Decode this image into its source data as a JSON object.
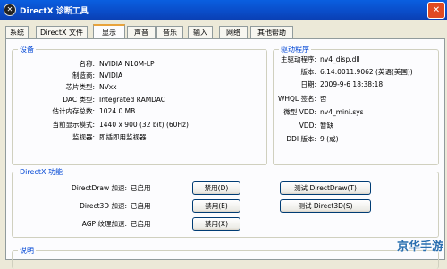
{
  "window": {
    "title": "DirectX 诊断工具",
    "close_glyph": "✕"
  },
  "tabs": [
    "系统",
    "DirectX 文件",
    "显示",
    "声音",
    "音乐",
    "输入",
    "网络",
    "其他帮助"
  ],
  "device": {
    "legend": "设备",
    "rows": [
      {
        "label": "名称:",
        "value": "NVIDIA N10M-LP"
      },
      {
        "label": "制造商:",
        "value": "NVIDIA"
      },
      {
        "label": "芯片类型:",
        "value": "NVxx"
      },
      {
        "label": "DAC 类型:",
        "value": "Integrated RAMDAC"
      },
      {
        "label": "估计内存总数:",
        "value": "1024.0 MB"
      },
      {
        "label": "当前显示模式:",
        "value": "1440 x 900 (32 bit) (60Hz)"
      },
      {
        "label": "监视器:",
        "value": "即插即用监视器"
      }
    ]
  },
  "driver": {
    "legend": "驱动程序",
    "rows": [
      {
        "label": "主驱动程序:",
        "value": "nv4_disp.dll"
      },
      {
        "label": "版本:",
        "value": "6.14.0011.9062 (英语(美国))"
      },
      {
        "label": "日期:",
        "value": "2009-9-6 18:38:18"
      },
      {
        "label": "WHQL 签名:",
        "value": "否"
      },
      {
        "label": "微型 VDD:",
        "value": "nv4_mini.sys"
      },
      {
        "label": "VDD:",
        "value": "暂缺"
      },
      {
        "label": "DDI 版本:",
        "value": "9 (或)"
      }
    ]
  },
  "directx": {
    "legend": "DirectX 功能",
    "rows": [
      {
        "label": "DirectDraw 加速:",
        "status": "已启用",
        "toggle": "禁用(D)",
        "test": "测试 DirectDraw(T)"
      },
      {
        "label": "Direct3D 加速:",
        "status": "已启用",
        "toggle": "禁用(E)",
        "test": "测试 Direct3D(S)"
      },
      {
        "label": "AGP 纹理加速:",
        "status": "已启用",
        "toggle": "禁用(X)"
      }
    ]
  },
  "notes": {
    "legend": "说明"
  },
  "watermark": "京华手游"
}
